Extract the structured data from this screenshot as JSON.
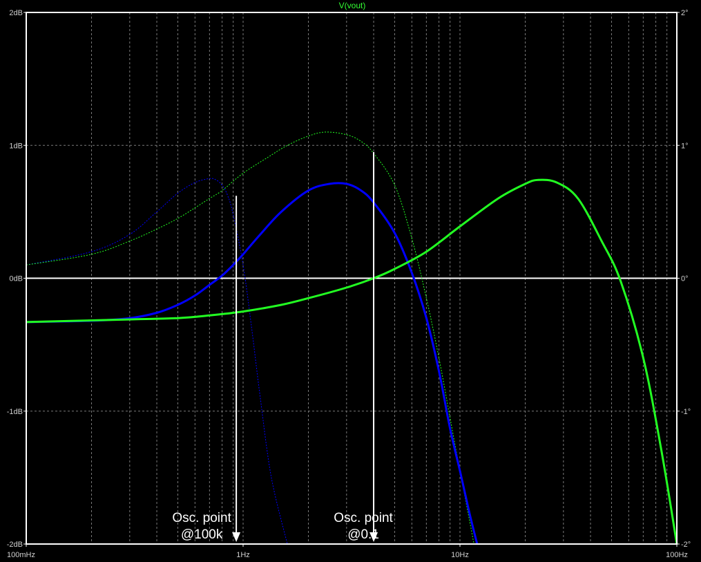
{
  "chart_data": {
    "type": "line",
    "title": "V(vout)",
    "x_scale": "log",
    "xlim": [
      0.1,
      100
    ],
    "ylim_left": [
      -2,
      2
    ],
    "ylim_right": [
      -2,
      2
    ],
    "grid": true,
    "x_ticks": [
      {
        "value": 0.1,
        "label": "100mHz"
      },
      {
        "value": 1,
        "label": "1Hz"
      },
      {
        "value": 10,
        "label": "10Hz"
      },
      {
        "value": 100,
        "label": "100Hz"
      }
    ],
    "y_ticks_left": [
      {
        "value": 2,
        "label": "2dB"
      },
      {
        "value": 1,
        "label": "1dB"
      },
      {
        "value": 0,
        "label": "0dB"
      },
      {
        "value": -1,
        "label": "-1dB"
      },
      {
        "value": -2,
        "label": "-2dB"
      }
    ],
    "y_ticks_right": [
      {
        "value": 2,
        "label": "2°"
      },
      {
        "value": 1,
        "label": "1°"
      },
      {
        "value": 0,
        "label": "0°"
      },
      {
        "value": -1,
        "label": "-1°"
      },
      {
        "value": -2,
        "label": "-2°"
      }
    ],
    "series": [
      {
        "color": "#0000ff",
        "style": "solid",
        "width": 3,
        "x": [
          0.1,
          0.2,
          0.3,
          0.4,
          0.5,
          0.6,
          0.7,
          0.8,
          0.9,
          1.0,
          1.2,
          1.5,
          2.0,
          2.5,
          3.0,
          3.5,
          4.0,
          5.0,
          6.0,
          7.0,
          8.0,
          9.0,
          10.0,
          11.0,
          12.0
        ],
        "y": [
          -0.33,
          -0.32,
          -0.3,
          -0.26,
          -0.2,
          -0.13,
          -0.05,
          0.02,
          0.1,
          0.18,
          0.33,
          0.5,
          0.66,
          0.71,
          0.71,
          0.66,
          0.57,
          0.34,
          0.04,
          -0.3,
          -0.7,
          -1.13,
          -1.45,
          -1.75,
          -2.0
        ]
      },
      {
        "color": "#22ff22",
        "style": "solid",
        "width": 3,
        "x": [
          0.1,
          0.3,
          0.5,
          0.7,
          1.0,
          1.5,
          2.0,
          3.0,
          4.0,
          5.0,
          7.0,
          10.0,
          15.0,
          20.0,
          23.0,
          28.0,
          35.0,
          45.0,
          55.0,
          70.0,
          85.0,
          100.0
        ],
        "y": [
          -0.33,
          -0.31,
          -0.3,
          -0.28,
          -0.25,
          -0.2,
          -0.15,
          -0.07,
          0.0,
          0.07,
          0.2,
          0.39,
          0.6,
          0.71,
          0.74,
          0.72,
          0.6,
          0.28,
          -0.02,
          -0.6,
          -1.3,
          -2.0
        ]
      },
      {
        "color": "#0000ff",
        "style": "dotted",
        "width": 1,
        "x": [
          0.1,
          0.2,
          0.3,
          0.4,
          0.5,
          0.6,
          0.7,
          0.75,
          0.8,
          0.85,
          0.9,
          1.0,
          1.1,
          1.2,
          1.35,
          1.6
        ],
        "y": [
          0.1,
          0.2,
          0.33,
          0.5,
          0.64,
          0.72,
          0.75,
          0.74,
          0.7,
          0.62,
          0.48,
          0.1,
          -0.4,
          -0.9,
          -1.5,
          -2.0
        ]
      },
      {
        "color": "#22ff22",
        "style": "dotted",
        "width": 1,
        "x": [
          0.1,
          0.2,
          0.3,
          0.4,
          0.5,
          0.6,
          0.7,
          0.8,
          1.0,
          1.3,
          1.6,
          2.0,
          2.4,
          3.0,
          3.5,
          4.0,
          5.0,
          6.0,
          7.0,
          8.0,
          9.0,
          10.0,
          11.0,
          11.6
        ],
        "y": [
          0.1,
          0.18,
          0.28,
          0.37,
          0.45,
          0.53,
          0.6,
          0.66,
          0.79,
          0.91,
          1.0,
          1.07,
          1.1,
          1.08,
          1.03,
          0.94,
          0.7,
          0.3,
          -0.15,
          -0.6,
          -1.05,
          -1.45,
          -1.8,
          -2.0
        ]
      }
    ],
    "markers": [
      {
        "x": 0.93,
        "y_from": 0.62,
        "label_lines": [
          "Osc. point",
          "@100k"
        ]
      },
      {
        "x": 4.0,
        "y_from": 0.95,
        "label_lines": [
          "Osc. point",
          "@0.1"
        ]
      }
    ]
  }
}
